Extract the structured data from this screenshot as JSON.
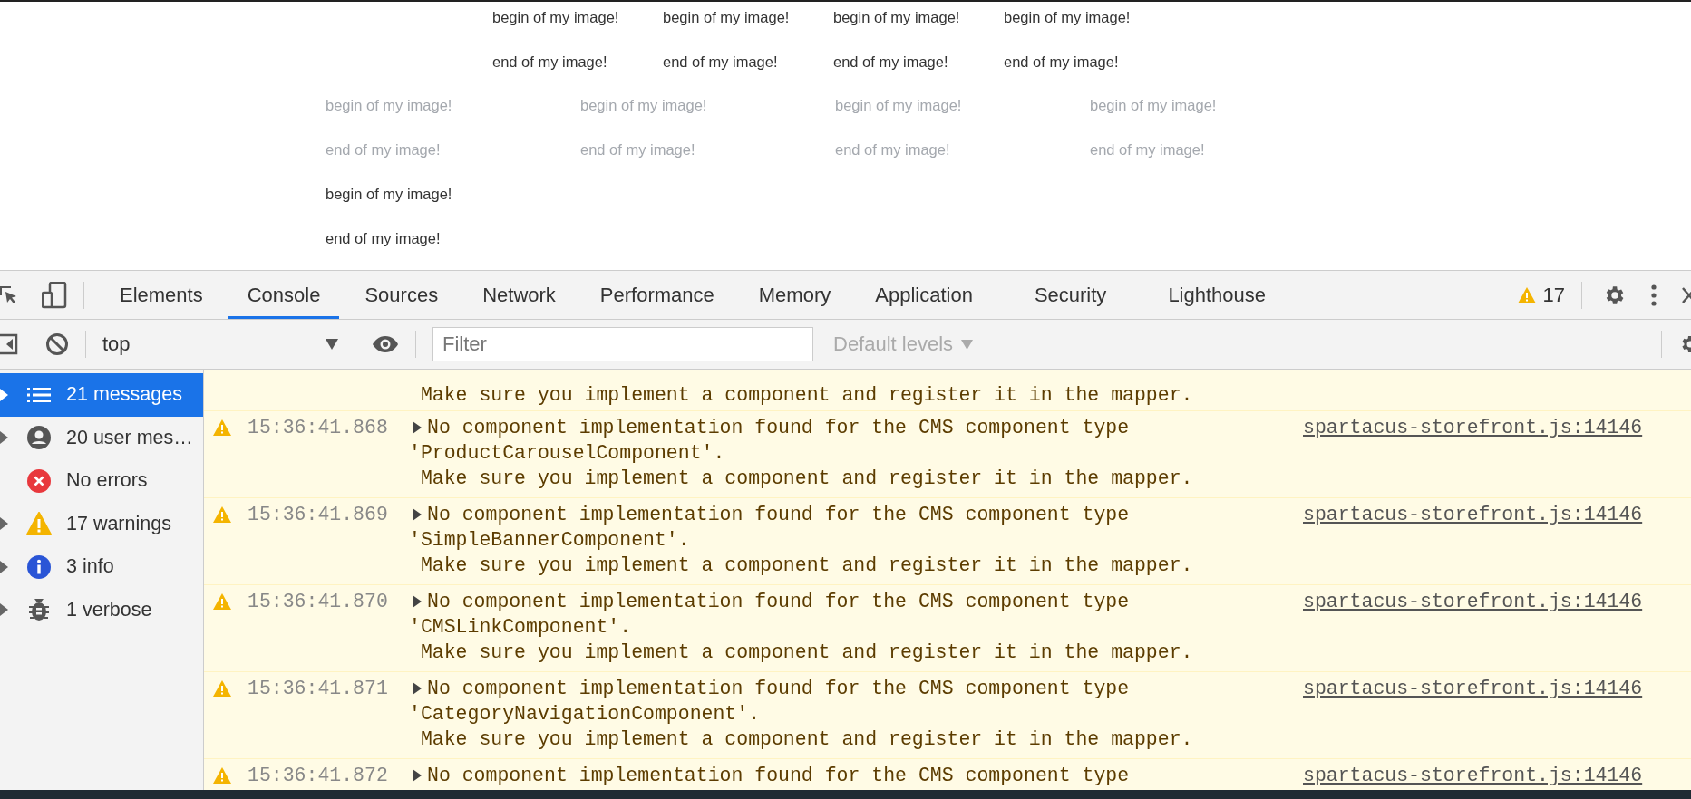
{
  "page": {
    "rows": [
      {
        "faded": false,
        "blocks": [
          {
            "begin": "begin of my image!",
            "end": "end of my image!"
          },
          {
            "begin": "begin of my image!",
            "end": "end of my image!"
          },
          {
            "begin": "begin of my image!",
            "end": "end of my image!"
          },
          {
            "begin": "begin of my image!",
            "end": "end of my image!"
          }
        ]
      },
      {
        "faded": true,
        "blocks": [
          {
            "begin": "begin of my image!",
            "end": "end of my image!"
          },
          {
            "begin": "begin of my image!",
            "end": "end of my image!"
          },
          {
            "begin": "begin of my image!",
            "end": "end of my image!"
          },
          {
            "begin": "begin of my image!",
            "end": "end of my image!"
          }
        ]
      },
      {
        "faded": false,
        "blocks": [
          {
            "begin": "begin of my image!",
            "end": "end of my image!"
          }
        ]
      }
    ]
  },
  "devtools": {
    "tabs": [
      {
        "label": "Elements",
        "selected": false
      },
      {
        "label": "Console",
        "selected": true
      },
      {
        "label": "Sources",
        "selected": false
      },
      {
        "label": "Network",
        "selected": false
      },
      {
        "label": "Performance",
        "selected": false
      },
      {
        "label": "Memory",
        "selected": false
      },
      {
        "label": "Application",
        "selected": false
      },
      {
        "label": "Security",
        "selected": false
      },
      {
        "label": "Lighthouse",
        "selected": false
      }
    ],
    "warning_count": "17",
    "toolbar": {
      "context": "top",
      "filter_placeholder": "Filter",
      "levels": "Default levels"
    },
    "sidebar": {
      "items": [
        {
          "kind": "all",
          "label": "21 messages",
          "selected": true,
          "expandable": true
        },
        {
          "kind": "user",
          "label": "20 user mes…",
          "selected": false,
          "expandable": true
        },
        {
          "kind": "error",
          "label": "No errors",
          "selected": false,
          "expandable": false
        },
        {
          "kind": "warning",
          "label": "17 warnings",
          "selected": false,
          "expandable": true
        },
        {
          "kind": "info",
          "label": "3 info",
          "selected": false,
          "expandable": true
        },
        {
          "kind": "verbose",
          "label": "1 verbose",
          "selected": false,
          "expandable": true
        }
      ]
    },
    "messages": [
      {
        "lines": [
          " Make sure you implement a component and register it in the mapper."
        ]
      },
      {
        "time": "15:36:41.868",
        "text": "No component implementation found for the CMS component type",
        "lines": [
          "'ProductCarouselComponent'.",
          " Make sure you implement a component and register it in the mapper."
        ],
        "source": "spartacus-storefront.js:14146"
      },
      {
        "time": "15:36:41.869",
        "text": "No component implementation found for the CMS component type",
        "lines": [
          "'SimpleBannerComponent'.",
          " Make sure you implement a component and register it in the mapper."
        ],
        "source": "spartacus-storefront.js:14146"
      },
      {
        "time": "15:36:41.870",
        "text": "No component implementation found for the CMS component type",
        "lines": [
          "'CMSLinkComponent'.",
          " Make sure you implement a component and register it in the mapper."
        ],
        "source": "spartacus-storefront.js:14146"
      },
      {
        "time": "15:36:41.871",
        "text": "No component implementation found for the CMS component type",
        "lines": [
          "'CategoryNavigationComponent'.",
          " Make sure you implement a component and register it in the mapper."
        ],
        "source": "spartacus-storefront.js:14146"
      },
      {
        "time": "15:36:41.872",
        "text": "No component implementation found for the CMS component type",
        "source": "spartacus-storefront.js:14146"
      }
    ]
  }
}
